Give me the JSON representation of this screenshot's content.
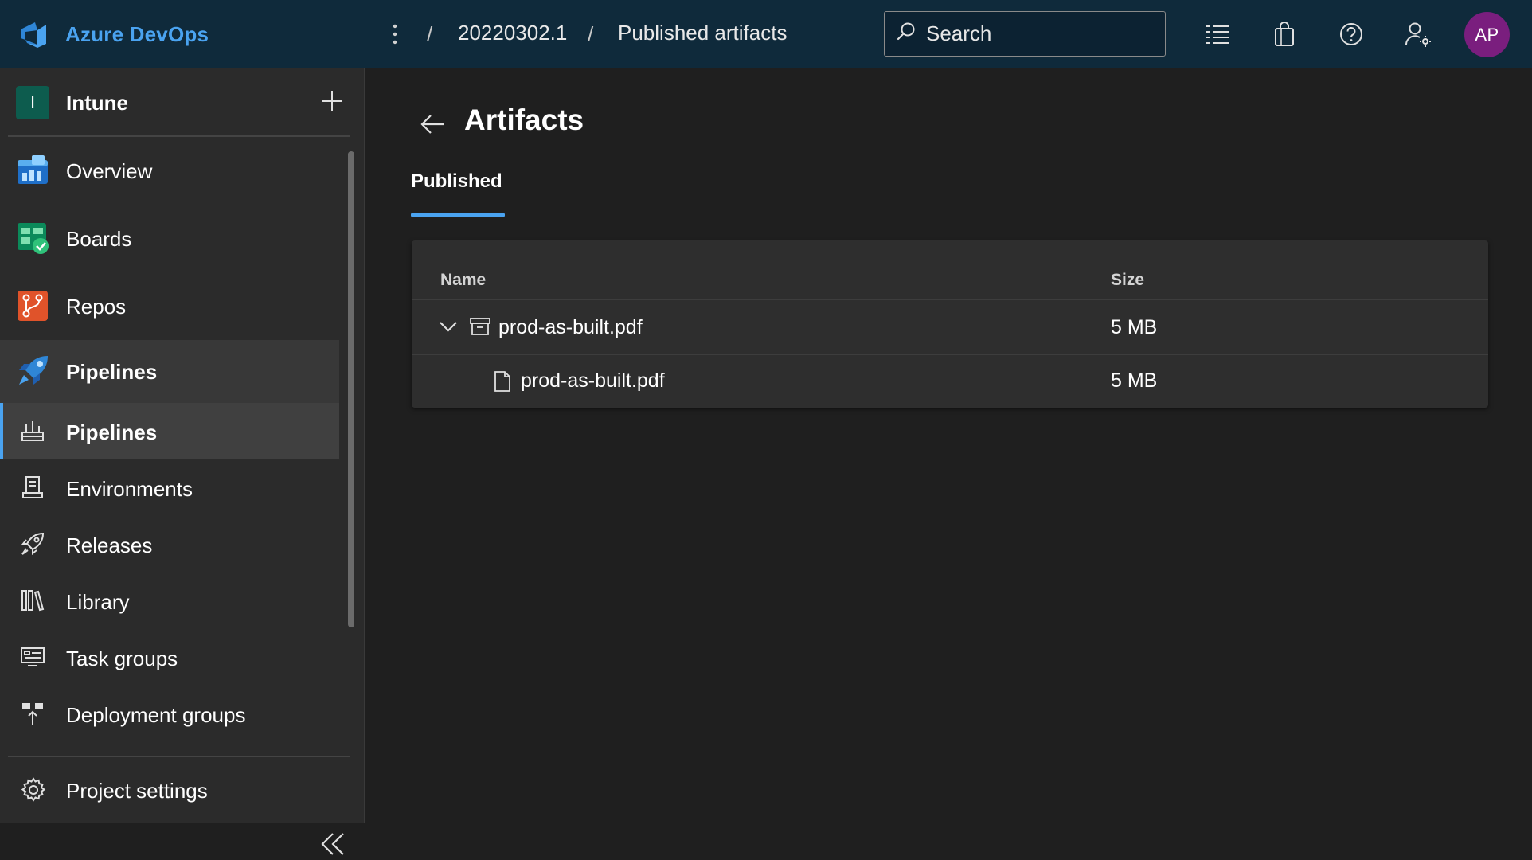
{
  "topbar": {
    "brand": "Azure DevOps",
    "breadcrumb": [
      {
        "label": "20220302.1"
      },
      {
        "label": "Published artifacts"
      }
    ],
    "search_placeholder": "Search",
    "icons": [
      "list-settings-icon",
      "shopping-bag-icon",
      "help-icon",
      "user-settings-icon"
    ],
    "avatar_initials": "AP",
    "avatar_color": "#7a1e7e",
    "background": "#0f2a3b",
    "brand_color": "#4aa3f0"
  },
  "sidebar": {
    "project": {
      "initial": "I",
      "name": "Intune",
      "badge_color": "#0d5c4e"
    },
    "items": [
      {
        "label": "Overview",
        "icon": "overview-icon"
      },
      {
        "label": "Boards",
        "icon": "boards-icon"
      },
      {
        "label": "Repos",
        "icon": "repos-icon"
      },
      {
        "label": "Pipelines",
        "icon": "pipelines-icon",
        "active": true
      }
    ],
    "subitems": [
      {
        "label": "Pipelines",
        "icon": "pipelines-sub-icon",
        "active": true
      },
      {
        "label": "Environments",
        "icon": "environments-icon"
      },
      {
        "label": "Releases",
        "icon": "releases-icon"
      },
      {
        "label": "Library",
        "icon": "library-icon"
      },
      {
        "label": "Task groups",
        "icon": "task-groups-icon"
      },
      {
        "label": "Deployment groups",
        "icon": "deployment-groups-icon"
      }
    ],
    "settings": "Project settings"
  },
  "main": {
    "title": "Artifacts",
    "tabs": [
      {
        "label": "Published",
        "active": true
      }
    ],
    "table": {
      "columns": [
        "Name",
        "Size"
      ],
      "rows": [
        {
          "name": "prod-as-built.pdf",
          "size": "5 MB",
          "type": "artifact",
          "expanded": true
        },
        {
          "name": "prod-as-built.pdf",
          "size": "5 MB",
          "type": "file"
        }
      ]
    },
    "accent": "#4aa3f0"
  }
}
